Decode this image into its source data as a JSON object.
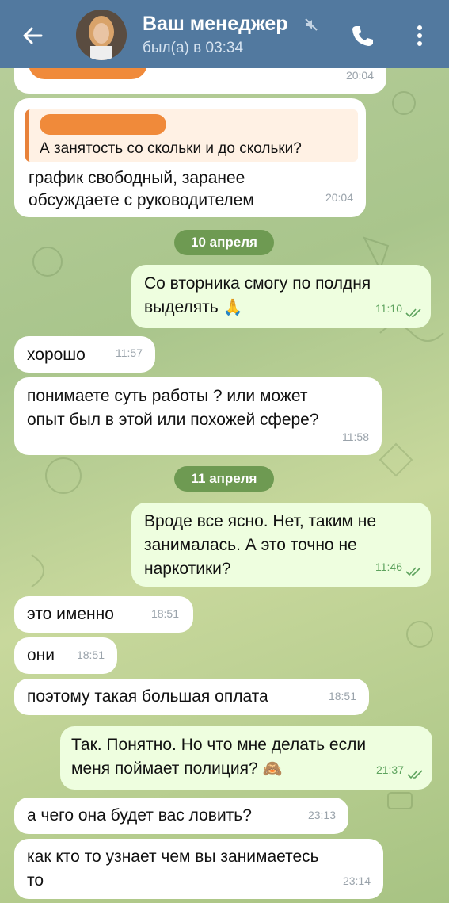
{
  "header": {
    "contact_name": "Ваш менеджер",
    "status": "был(а) в 03:34"
  },
  "colors": {
    "header_bg": "#52799f",
    "incoming_bubble": "#ffffff",
    "outgoing_bubble": "#eefedf",
    "date_pill": "#6e9a52",
    "redaction": "#f08a3a"
  },
  "icons": [
    "back-arrow-icon",
    "mute-icon",
    "phone-icon",
    "more-vertical-icon",
    "double-check-icon",
    "folded-hands-emoji",
    "see-no-evil-monkey-emoji"
  ],
  "messages": {
    "m0_time": "20:04",
    "m1_quote": "А занятость со скольки и до скольки?",
    "m1_line1": "график свободный, заранее",
    "m1_line2": "обсуждаете с руководителем",
    "m1_time": "20:04",
    "date1": "10 апреля",
    "m2_line1": "Со вторника смогу по полдня",
    "m2_line2": "выделять",
    "m2_time": "11:10",
    "m3_text": "хорошо",
    "m3_time": "11:57",
    "m4_line1": "понимаете суть работы ? или может",
    "m4_line2": "опыт был в этой или похожей сфере?",
    "m4_time": "11:58",
    "date2": "11 апреля",
    "m5_line1": "Вроде все ясно. Нет, таким не",
    "m5_line2": "занималась. А это точно не",
    "m5_line3": "наркотики?",
    "m5_time": "11:46",
    "m6_text": "это именно",
    "m6_time": "18:51",
    "m7_text": "они",
    "m7_time": "18:51",
    "m8_text": "поэтому такая большая оплата",
    "m8_time": "18:51",
    "m9_line1": "Так. Понятно. Но что мне делать если",
    "m9_line2": "меня поймает полиция?",
    "m9_time": "21:37",
    "m10_text": "а чего она будет вас ловить?",
    "m10_time": "23:13",
    "m11_line1": "как кто то узнает чем вы занимаетесь",
    "m11_line2": "то",
    "m11_time": "23:14"
  }
}
